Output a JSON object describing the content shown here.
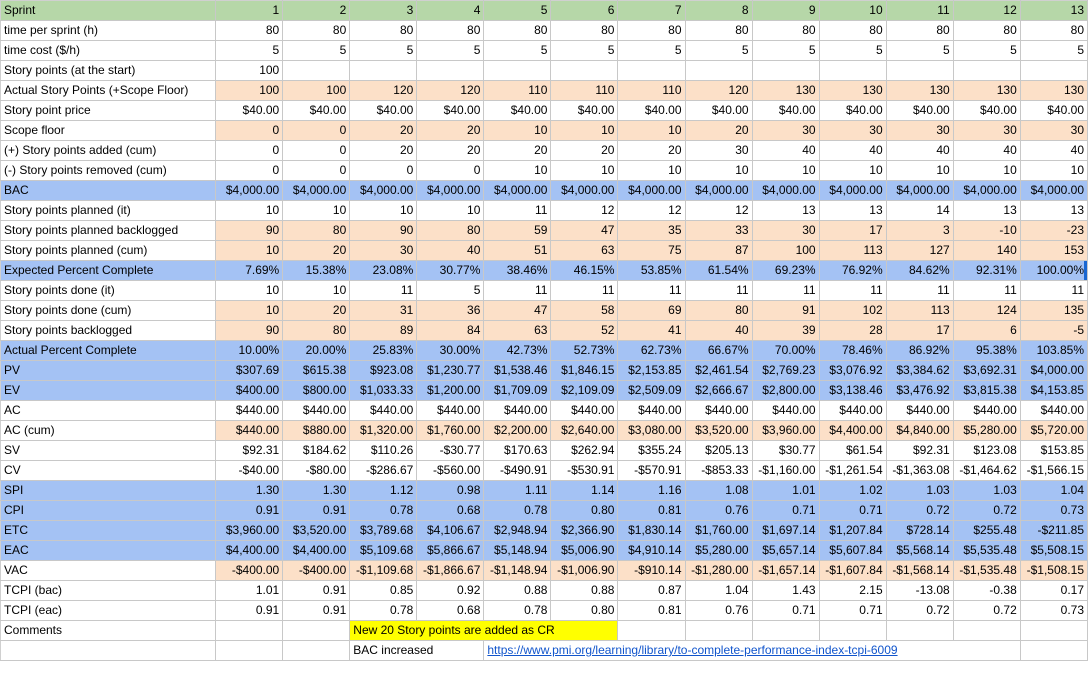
{
  "sheet": {
    "title": "Sprint EVM tracking sheet",
    "header_label": "Sprint",
    "sprints": [
      "1",
      "2",
      "3",
      "4",
      "5",
      "6",
      "7",
      "8",
      "9",
      "10",
      "11",
      "12",
      "13"
    ],
    "colors": {
      "header_green": "#b6d7a8",
      "highlight_peach": "#fce0c8",
      "highlight_blue": "#a4c2f4",
      "note_yellow": "#ffff00",
      "link_blue": "#1155cc",
      "selection_blue": "#1967d2"
    }
  },
  "rows": [
    {
      "label": "time per sprint (h)",
      "style": "white",
      "values": [
        "80",
        "80",
        "80",
        "80",
        "80",
        "80",
        "80",
        "80",
        "80",
        "80",
        "80",
        "80",
        "80"
      ]
    },
    {
      "label": "time cost ($/h)",
      "style": "white",
      "values": [
        "5",
        "5",
        "5",
        "5",
        "5",
        "5",
        "5",
        "5",
        "5",
        "5",
        "5",
        "5",
        "5"
      ]
    },
    {
      "label": "Story points (at the start)",
      "style": "white",
      "values": [
        "100",
        "",
        "",
        "",
        "",
        "",
        "",
        "",
        "",
        "",
        "",
        "",
        ""
      ]
    },
    {
      "label": "Actual Story Points (+Scope Floor)",
      "style": "peach",
      "values": [
        "100",
        "100",
        "120",
        "120",
        "110",
        "110",
        "110",
        "120",
        "130",
        "130",
        "130",
        "130",
        "130"
      ]
    },
    {
      "label": "Story point price",
      "style": "white",
      "values": [
        "$40.00",
        "$40.00",
        "$40.00",
        "$40.00",
        "$40.00",
        "$40.00",
        "$40.00",
        "$40.00",
        "$40.00",
        "$40.00",
        "$40.00",
        "$40.00",
        "$40.00"
      ]
    },
    {
      "label": "Scope floor",
      "style": "peach",
      "values": [
        "0",
        "0",
        "20",
        "20",
        "10",
        "10",
        "10",
        "20",
        "30",
        "30",
        "30",
        "30",
        "30"
      ]
    },
    {
      "label": "(+) Story points added (cum)",
      "style": "white",
      "values": [
        "0",
        "0",
        "20",
        "20",
        "20",
        "20",
        "20",
        "30",
        "40",
        "40",
        "40",
        "40",
        "40"
      ]
    },
    {
      "label": "(-) Story points removed (cum)",
      "style": "white",
      "values": [
        "0",
        "0",
        "0",
        "0",
        "10",
        "10",
        "10",
        "10",
        "10",
        "10",
        "10",
        "10",
        "10"
      ]
    },
    {
      "label": "BAC",
      "style": "blue",
      "values": [
        "$4,000.00",
        "$4,000.00",
        "$4,000.00",
        "$4,000.00",
        "$4,000.00",
        "$4,000.00",
        "$4,000.00",
        "$4,000.00",
        "$4,000.00",
        "$4,000.00",
        "$4,000.00",
        "$4,000.00",
        "$4,000.00"
      ]
    },
    {
      "label": "Story points planned (it)",
      "style": "white",
      "values": [
        "10",
        "10",
        "10",
        "10",
        "11",
        "12",
        "12",
        "12",
        "13",
        "13",
        "14",
        "13",
        "13"
      ]
    },
    {
      "label": "Story points planned backlogged",
      "style": "peach",
      "values": [
        "90",
        "80",
        "90",
        "80",
        "59",
        "47",
        "35",
        "33",
        "30",
        "17",
        "3",
        "-10",
        "-23"
      ]
    },
    {
      "label": "Story points planned (cum)",
      "style": "peach",
      "values": [
        "10",
        "20",
        "30",
        "40",
        "51",
        "63",
        "75",
        "87",
        "100",
        "113",
        "127",
        "140",
        "153"
      ]
    },
    {
      "label": "Expected Percent Complete",
      "style": "blue",
      "values": [
        "7.69%",
        "15.38%",
        "23.08%",
        "30.77%",
        "38.46%",
        "46.15%",
        "53.85%",
        "61.54%",
        "69.23%",
        "76.92%",
        "84.62%",
        "92.31%",
        "100.00%"
      ],
      "selected_last": true
    },
    {
      "label": "Story points done (it)",
      "style": "white",
      "values": [
        "10",
        "10",
        "11",
        "5",
        "11",
        "11",
        "11",
        "11",
        "11",
        "11",
        "11",
        "11",
        "11"
      ]
    },
    {
      "label": "Story points done (cum)",
      "style": "peach",
      "values": [
        "10",
        "20",
        "31",
        "36",
        "47",
        "58",
        "69",
        "80",
        "91",
        "102",
        "113",
        "124",
        "135"
      ]
    },
    {
      "label": "Story points backlogged",
      "style": "peach",
      "values": [
        "90",
        "80",
        "89",
        "84",
        "63",
        "52",
        "41",
        "40",
        "39",
        "28",
        "17",
        "6",
        "-5"
      ]
    },
    {
      "label": "Actual Percent Complete",
      "style": "blue",
      "values": [
        "10.00%",
        "20.00%",
        "25.83%",
        "30.00%",
        "42.73%",
        "52.73%",
        "62.73%",
        "66.67%",
        "70.00%",
        "78.46%",
        "86.92%",
        "95.38%",
        "103.85%"
      ]
    },
    {
      "label": "PV",
      "style": "blue",
      "values": [
        "$307.69",
        "$615.38",
        "$923.08",
        "$1,230.77",
        "$1,538.46",
        "$1,846.15",
        "$2,153.85",
        "$2,461.54",
        "$2,769.23",
        "$3,076.92",
        "$3,384.62",
        "$3,692.31",
        "$4,000.00"
      ]
    },
    {
      "label": "EV",
      "style": "blue",
      "values": [
        "$400.00",
        "$800.00",
        "$1,033.33",
        "$1,200.00",
        "$1,709.09",
        "$2,109.09",
        "$2,509.09",
        "$2,666.67",
        "$2,800.00",
        "$3,138.46",
        "$3,476.92",
        "$3,815.38",
        "$4,153.85"
      ]
    },
    {
      "label": "AC",
      "style": "white",
      "values": [
        "$440.00",
        "$440.00",
        "$440.00",
        "$440.00",
        "$440.00",
        "$440.00",
        "$440.00",
        "$440.00",
        "$440.00",
        "$440.00",
        "$440.00",
        "$440.00",
        "$440.00"
      ]
    },
    {
      "label": "AC (cum)",
      "style": "peach",
      "values": [
        "$440.00",
        "$880.00",
        "$1,320.00",
        "$1,760.00",
        "$2,200.00",
        "$2,640.00",
        "$3,080.00",
        "$3,520.00",
        "$3,960.00",
        "$4,400.00",
        "$4,840.00",
        "$5,280.00",
        "$5,720.00"
      ]
    },
    {
      "label": "SV",
      "style": "white",
      "values": [
        "$92.31",
        "$184.62",
        "$110.26",
        "-$30.77",
        "$170.63",
        "$262.94",
        "$355.24",
        "$205.13",
        "$30.77",
        "$61.54",
        "$92.31",
        "$123.08",
        "$153.85"
      ]
    },
    {
      "label": "CV",
      "style": "white",
      "values": [
        "-$40.00",
        "-$80.00",
        "-$286.67",
        "-$560.00",
        "-$490.91",
        "-$530.91",
        "-$570.91",
        "-$853.33",
        "-$1,160.00",
        "-$1,261.54",
        "-$1,363.08",
        "-$1,464.62",
        "-$1,566.15"
      ]
    },
    {
      "label": "SPI",
      "style": "blue",
      "values": [
        "1.30",
        "1.30",
        "1.12",
        "0.98",
        "1.11",
        "1.14",
        "1.16",
        "1.08",
        "1.01",
        "1.02",
        "1.03",
        "1.03",
        "1.04"
      ]
    },
    {
      "label": "CPI",
      "style": "blue",
      "values": [
        "0.91",
        "0.91",
        "0.78",
        "0.68",
        "0.78",
        "0.80",
        "0.81",
        "0.76",
        "0.71",
        "0.71",
        "0.72",
        "0.72",
        "0.73"
      ]
    },
    {
      "label": "ETC",
      "style": "blue",
      "values": [
        "$3,960.00",
        "$3,520.00",
        "$3,789.68",
        "$4,106.67",
        "$2,948.94",
        "$2,366.90",
        "$1,830.14",
        "$1,760.00",
        "$1,697.14",
        "$1,207.84",
        "$728.14",
        "$255.48",
        "-$211.85"
      ]
    },
    {
      "label": "EAC",
      "style": "blue",
      "values": [
        "$4,400.00",
        "$4,400.00",
        "$5,109.68",
        "$5,866.67",
        "$5,148.94",
        "$5,006.90",
        "$4,910.14",
        "$5,280.00",
        "$5,657.14",
        "$5,607.84",
        "$5,568.14",
        "$5,535.48",
        "$5,508.15"
      ]
    },
    {
      "label": "VAC",
      "style": "peach",
      "values": [
        "-$400.00",
        "-$400.00",
        "-$1,109.68",
        "-$1,866.67",
        "-$1,148.94",
        "-$1,006.90",
        "-$910.14",
        "-$1,280.00",
        "-$1,657.14",
        "-$1,607.84",
        "-$1,568.14",
        "-$1,535.48",
        "-$1,508.15"
      ]
    },
    {
      "label": "TCPI (bac)",
      "style": "white",
      "values": [
        "1.01",
        "0.91",
        "0.85",
        "0.92",
        "0.88",
        "0.88",
        "0.87",
        "1.04",
        "1.43",
        "2.15",
        "-13.08",
        "-0.38",
        "0.17"
      ]
    },
    {
      "label": "TCPI (eac)",
      "style": "white",
      "values": [
        "0.91",
        "0.91",
        "0.78",
        "0.68",
        "0.78",
        "0.80",
        "0.81",
        "0.76",
        "0.71",
        "0.71",
        "0.72",
        "0.72",
        "0.73"
      ]
    }
  ],
  "footer": {
    "comments_label": "Comments",
    "note_text": "New 20 Story points are added as CR",
    "note_start_col": 3,
    "note_span": 4,
    "bac_note": "BAC increased",
    "bac_note_col": 3,
    "link_text": "https://www.pmi.org/learning/library/to-complete-performance-index-tcpi-6009",
    "link_start_col": 5,
    "link_span": 8
  }
}
